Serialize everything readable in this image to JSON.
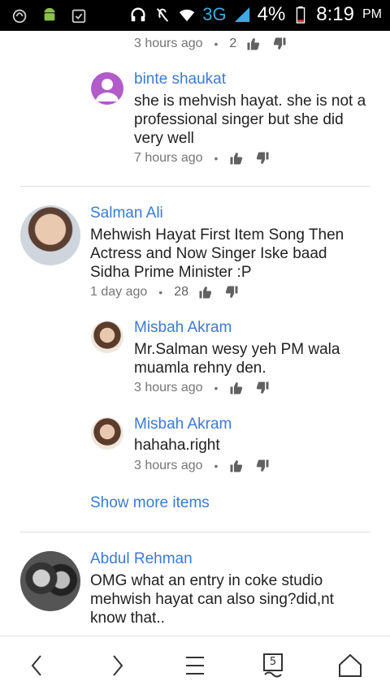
{
  "status": {
    "network": "3G",
    "battery": "4%",
    "time": "8:19",
    "ampm": "PM"
  },
  "comments": {
    "top_meta": {
      "time": "3 hours ago",
      "likes": "2"
    },
    "binte": {
      "name": "binte shaukat",
      "line1": "she is mehvish hayat. she is not a",
      "line2": "professional singer but she did",
      "line3": "very well",
      "time": "7 hours ago"
    },
    "salman": {
      "name": "Salman Ali",
      "line1": "Mehwish Hayat First Item Song Then",
      "line2": "Actress and Now Singer Iske baad",
      "line3": "Sidha Prime Minister :P",
      "time": "1 day ago",
      "likes": "28"
    },
    "misbah1": {
      "name": "Misbah Akram",
      "line1": "Mr.Salman wesy yeh PM wala",
      "line2": "muamla rehny den.",
      "time": "3 hours ago"
    },
    "misbah2": {
      "name": "Misbah Akram",
      "line1": "hahaha.right",
      "time": "3 hours ago"
    },
    "show_more": "Show more items",
    "abdul": {
      "name": "Abdul Rehman",
      "line1": "OMG what an entry in coke studio",
      "line2": "mehwish hayat can also sing?did,nt",
      "line3": "know that.."
    }
  },
  "nav": {
    "tabs_count": "5"
  },
  "colors": {
    "link": "#3b7ad4",
    "meta": "#757575"
  }
}
